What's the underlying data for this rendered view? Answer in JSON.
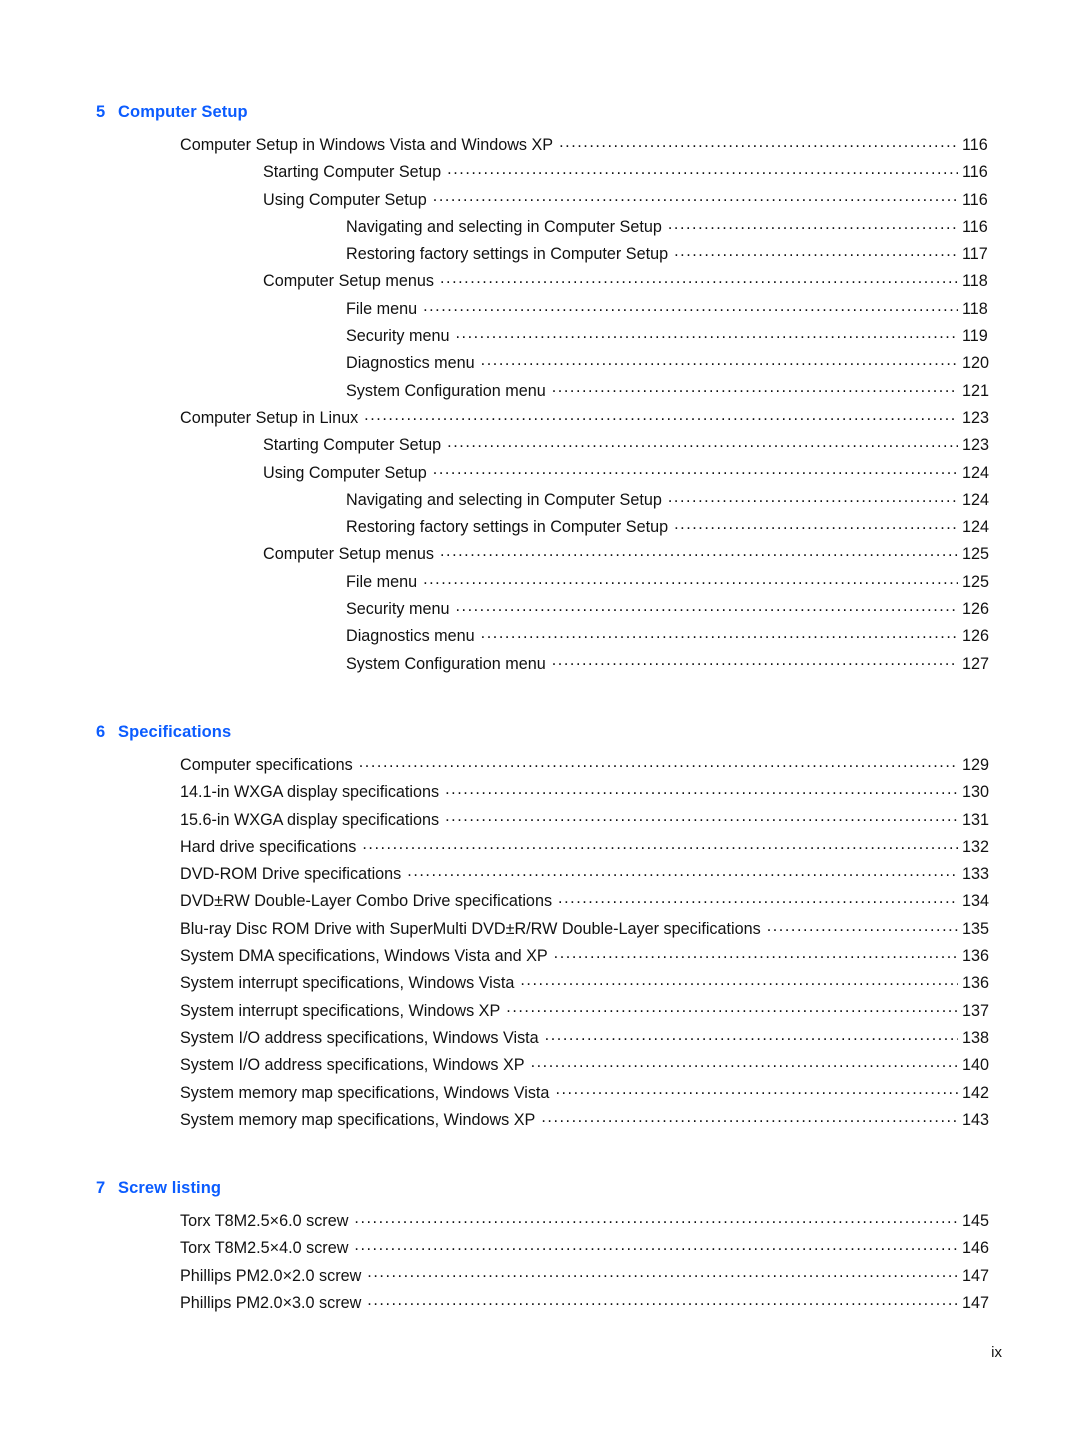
{
  "document": {
    "type": "table-of-contents",
    "folio": "ix",
    "heading_color": "#0b5cff",
    "text_color": "#111111"
  },
  "sections": [
    {
      "number": "5",
      "title": "Computer Setup",
      "entries": [
        {
          "label": "Computer Setup in Windows Vista and Windows XP",
          "page": "116",
          "level": 1
        },
        {
          "label": "Starting Computer Setup",
          "page": "116",
          "level": 2
        },
        {
          "label": "Using Computer Setup",
          "page": "116",
          "level": 2
        },
        {
          "label": "Navigating and selecting in Computer Setup",
          "page": "116",
          "level": 3
        },
        {
          "label": "Restoring factory settings in Computer Setup",
          "page": "117",
          "level": 3
        },
        {
          "label": "Computer Setup menus",
          "page": "118",
          "level": 2
        },
        {
          "label": "File menu",
          "page": "118",
          "level": 3
        },
        {
          "label": "Security menu",
          "page": "119",
          "level": 3
        },
        {
          "label": "Diagnostics menu",
          "page": "120",
          "level": 3
        },
        {
          "label": "System Configuration menu",
          "page": "121",
          "level": 3
        },
        {
          "label": "Computer Setup in Linux",
          "page": "123",
          "level": 1
        },
        {
          "label": "Starting Computer Setup",
          "page": "123",
          "level": 2
        },
        {
          "label": "Using Computer Setup",
          "page": "124",
          "level": 2
        },
        {
          "label": "Navigating and selecting in Computer Setup",
          "page": "124",
          "level": 3
        },
        {
          "label": "Restoring factory settings in Computer Setup",
          "page": "124",
          "level": 3
        },
        {
          "label": "Computer Setup menus",
          "page": "125",
          "level": 2
        },
        {
          "label": "File menu",
          "page": "125",
          "level": 3
        },
        {
          "label": "Security menu",
          "page": "126",
          "level": 3
        },
        {
          "label": "Diagnostics menu",
          "page": "126",
          "level": 3
        },
        {
          "label": "System Configuration menu",
          "page": "127",
          "level": 3
        }
      ]
    },
    {
      "number": "6",
      "title": "Specifications",
      "entries": [
        {
          "label": "Computer specifications",
          "page": "129",
          "level": 1
        },
        {
          "label": "14.1-in WXGA display specifications",
          "page": "130",
          "level": 1
        },
        {
          "label": "15.6-in WXGA display specifications",
          "page": "131",
          "level": 1
        },
        {
          "label": "Hard drive specifications",
          "page": "132",
          "level": 1
        },
        {
          "label": "DVD-ROM Drive specifications",
          "page": "133",
          "level": 1
        },
        {
          "label": "DVD±RW Double-Layer Combo Drive specifications",
          "page": "134",
          "level": 1
        },
        {
          "label": "Blu-ray Disc ROM Drive with SuperMulti DVD±R/RW Double-Layer specifications",
          "page": "135",
          "level": 1
        },
        {
          "label": "System DMA specifications, Windows Vista and XP",
          "page": "136",
          "level": 1
        },
        {
          "label": "System interrupt specifications, Windows Vista",
          "page": "136",
          "level": 1
        },
        {
          "label": "System interrupt specifications, Windows XP",
          "page": "137",
          "level": 1
        },
        {
          "label": "System I/O address specifications, Windows Vista",
          "page": "138",
          "level": 1
        },
        {
          "label": "System I/O address specifications, Windows XP",
          "page": "140",
          "level": 1
        },
        {
          "label": "System memory map specifications, Windows Vista",
          "page": "142",
          "level": 1
        },
        {
          "label": "System memory map specifications, Windows XP",
          "page": "143",
          "level": 1
        }
      ]
    },
    {
      "number": "7",
      "title": "Screw listing",
      "entries": [
        {
          "label": "Torx T8M2.5×6.0 screw",
          "page": "145",
          "level": 1
        },
        {
          "label": "Torx T8M2.5×4.0 screw",
          "page": "146",
          "level": 1
        },
        {
          "label": "Phillips PM2.0×2.0 screw",
          "page": "147",
          "level": 1
        },
        {
          "label": "Phillips PM2.0×3.0 screw",
          "page": "147",
          "level": 1
        }
      ]
    }
  ]
}
